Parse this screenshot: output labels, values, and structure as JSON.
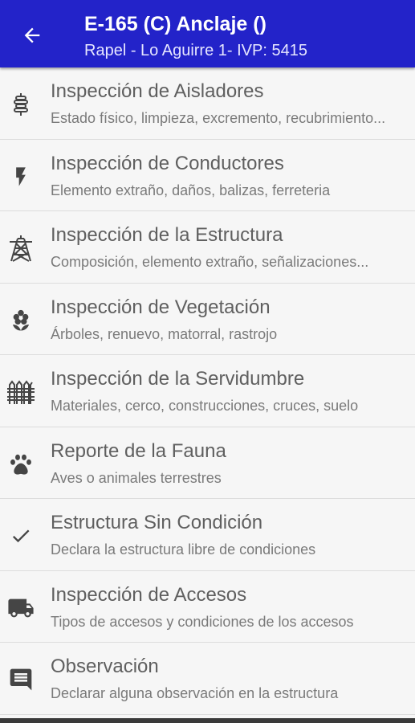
{
  "appbar": {
    "title": "E-165 (C) Anclaje ()",
    "subtitle": "Rapel - Lo Aguirre 1- IVP: 5415",
    "back_icon": "arrow-left-icon",
    "color": "#2323c9"
  },
  "items": [
    {
      "icon": "insulator-icon",
      "label": "Inspección de Aisladores",
      "description": "Estado físico, limpieza, excremento, recubrimiento..."
    },
    {
      "icon": "lightning-icon",
      "label": "Inspección de Conductores",
      "description": "Elemento extraño, daños, balizas, ferreteria"
    },
    {
      "icon": "tower-icon",
      "label": "Inspección de la Estructura",
      "description": "Composición, elemento extraño, señalizaciones..."
    },
    {
      "icon": "flower-icon",
      "label": "Inspección de Vegetación",
      "description": "Árboles, renuevo, matorral, rastrojo"
    },
    {
      "icon": "fence-icon",
      "label": "Inspección de la Servidumbre",
      "description": "Materiales, cerco, construcciones, cruces, suelo"
    },
    {
      "icon": "paw-icon",
      "label": "Reporte de la Fauna",
      "description": "Aves o animales terrestres"
    },
    {
      "icon": "check-icon",
      "label": "Estructura Sin Condición",
      "description": "Declara la estructura libre de condiciones"
    },
    {
      "icon": "truck-icon",
      "label": "Inspección de Accesos",
      "description": "Tipos de accesos y condiciones de los accesos"
    },
    {
      "icon": "comment-icon",
      "label": "Observación",
      "description": "Declarar alguna observación en la estructura"
    }
  ]
}
